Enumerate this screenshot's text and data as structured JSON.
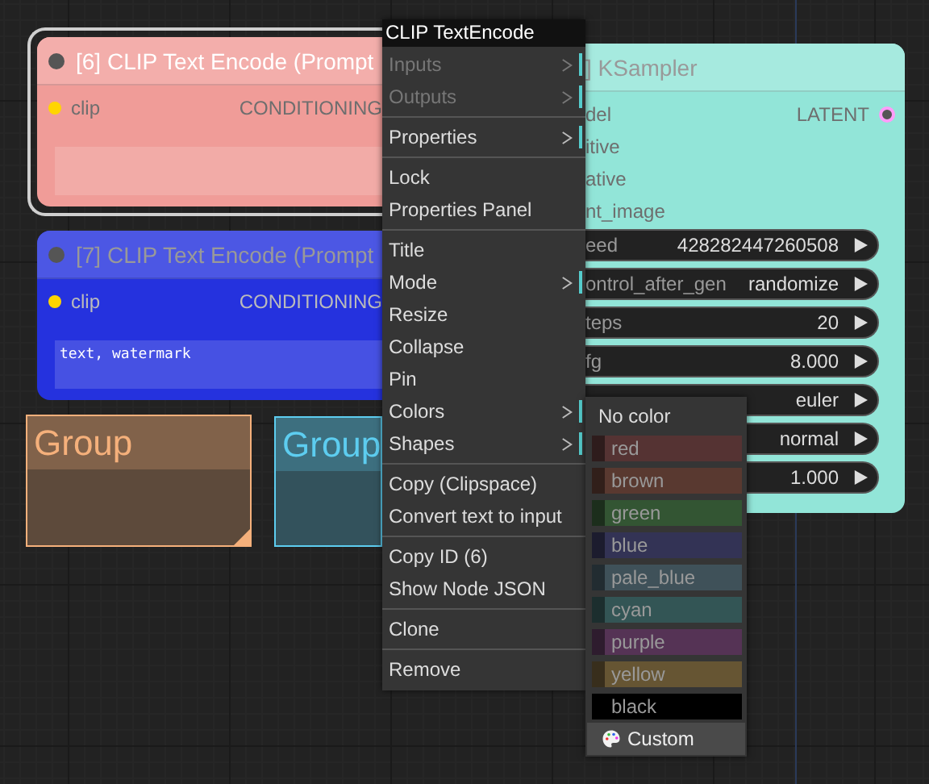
{
  "canvas": {
    "nodes": [
      {
        "kind": "text_encode",
        "title": "[6] CLIP Text Encode (Prompt",
        "selected": true,
        "color": "#f09c98",
        "inputs": [
          {
            "label": "clip",
            "color": "#ffd500"
          }
        ],
        "outputs": [
          {
            "label": "CONDITIONING"
          }
        ]
      },
      {
        "kind": "text_encode",
        "title": "[7] CLIP Text Encode (Prompt",
        "selected": false,
        "color": "#2532de",
        "inputs": [
          {
            "label": "clip",
            "color": "#ffd500"
          }
        ],
        "outputs": [
          {
            "label": "CONDITIONING"
          }
        ],
        "prompt": "text, watermark"
      },
      {
        "kind": "sampler",
        "title": "] KSampler",
        "selected": false,
        "color": "#92e5d8",
        "inputs": [
          {
            "label": "del"
          },
          {
            "label": "itive"
          },
          {
            "label": "ative"
          },
          {
            "label": "nt_image"
          }
        ],
        "outputs": [
          {
            "label": "LATENT",
            "color": "#ff9cf9"
          }
        ],
        "widgets": [
          {
            "label": "eed",
            "value": "428282447260508"
          },
          {
            "label": "ontrol_after_gen",
            "value": "randomize"
          },
          {
            "label": "teps",
            "value": "20"
          },
          {
            "label": "fg",
            "value": "8.000"
          },
          {
            "value": "euler"
          },
          {
            "value": "normal"
          },
          {
            "value": "1.000"
          }
        ]
      }
    ],
    "groups": [
      {
        "title": "Group",
        "color": "#f5b07b",
        "resize_handle": true
      },
      {
        "title": "Group",
        "color": "#5dcdf0",
        "resize_handle": false
      }
    ]
  },
  "context_menu": {
    "title": "CLIP TextEncode",
    "sections": [
      [
        {
          "label": "Inputs",
          "disabled": true,
          "submenu": true
        },
        {
          "label": "Outputs",
          "disabled": true,
          "submenu": true
        }
      ],
      [
        {
          "label": "Properties",
          "disabled": false,
          "submenu": true
        }
      ],
      [
        {
          "label": "Lock",
          "disabled": false,
          "submenu": false
        },
        {
          "label": "Properties Panel",
          "disabled": false,
          "submenu": false
        }
      ],
      [
        {
          "label": "Title",
          "disabled": false,
          "submenu": false
        },
        {
          "label": "Mode",
          "disabled": false,
          "submenu": true
        },
        {
          "label": "Resize",
          "disabled": false,
          "submenu": false
        },
        {
          "label": "Collapse",
          "disabled": false,
          "submenu": false
        },
        {
          "label": "Pin",
          "disabled": false,
          "submenu": false
        },
        {
          "label": "Colors",
          "disabled": false,
          "submenu": true
        },
        {
          "label": "Shapes",
          "disabled": false,
          "submenu": true
        }
      ],
      [
        {
          "label": "Copy (Clipspace)",
          "disabled": false,
          "submenu": false
        },
        {
          "label": "Convert text to input",
          "disabled": false,
          "submenu": false
        }
      ],
      [
        {
          "label": "Copy ID (6)",
          "disabled": false,
          "submenu": false
        },
        {
          "label": "Show Node JSON",
          "disabled": false,
          "submenu": false
        }
      ],
      [
        {
          "label": "Clone",
          "disabled": false,
          "submenu": false
        }
      ],
      [
        {
          "label": "Remove",
          "disabled": false,
          "submenu": false
        }
      ]
    ]
  },
  "colors_submenu": {
    "items": [
      {
        "kind": "none",
        "label": "No color"
      },
      {
        "kind": "swatch",
        "label": "red",
        "color": "#553333"
      },
      {
        "kind": "swatch",
        "label": "brown",
        "color": "#593930"
      },
      {
        "kind": "swatch",
        "label": "green",
        "color": "#335533"
      },
      {
        "kind": "swatch",
        "label": "blue",
        "color": "#333355"
      },
      {
        "kind": "swatch",
        "label": "pale_blue",
        "color": "#3f5159"
      },
      {
        "kind": "swatch",
        "label": "cyan",
        "color": "#335555"
      },
      {
        "kind": "swatch",
        "label": "purple",
        "color": "#553355"
      },
      {
        "kind": "swatch",
        "label": "yellow",
        "color": "#665533"
      },
      {
        "kind": "swatch",
        "label": "black",
        "color": "#000000"
      },
      {
        "kind": "custom",
        "label": "Custom"
      }
    ]
  }
}
